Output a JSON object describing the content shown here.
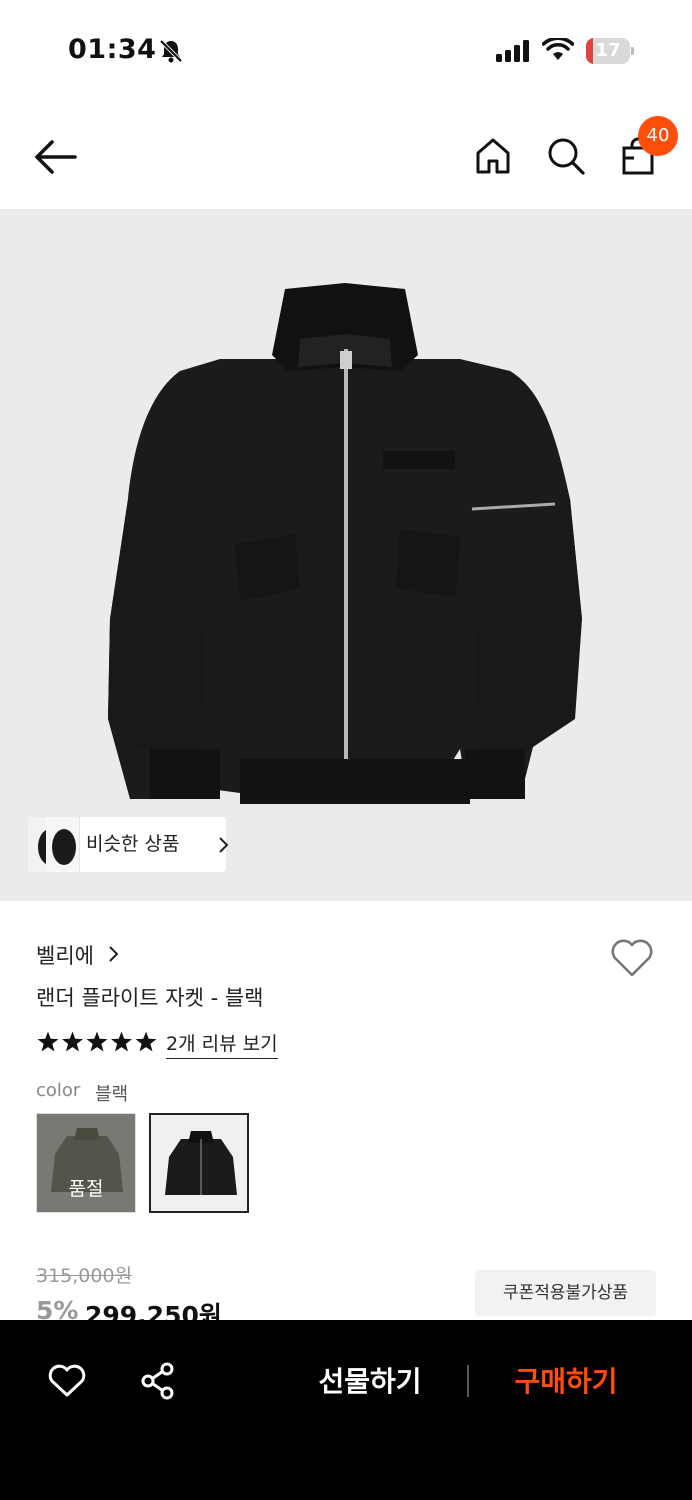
{
  "status_bar": {
    "time": "01:34",
    "battery_level": "17",
    "battery_fraction": 0.17
  },
  "header": {
    "cart_badge": "40"
  },
  "hero": {
    "similar_label": "비슷한 상품"
  },
  "product": {
    "brand": "벨리에",
    "title": "랜더 플라이트 자켓 - 블랙",
    "rating_stars": 5,
    "review_link": "2개 리뷰 보기",
    "color_label": "color",
    "color_value": "블랙",
    "swatches": [
      {
        "state": "품절"
      },
      {
        "state": ""
      }
    ],
    "original_price": "315,000원",
    "discount": "5%",
    "price": "299,250원",
    "coupon_badge": "쿠폰적용불가상품"
  },
  "bottom_bar": {
    "gift_label": "선물하기",
    "buy_label": "구매하기"
  },
  "colors": {
    "accent": "#ff4d0a",
    "bottom_bar_bg": "#000000",
    "hero_bg": "#ebebeb"
  }
}
